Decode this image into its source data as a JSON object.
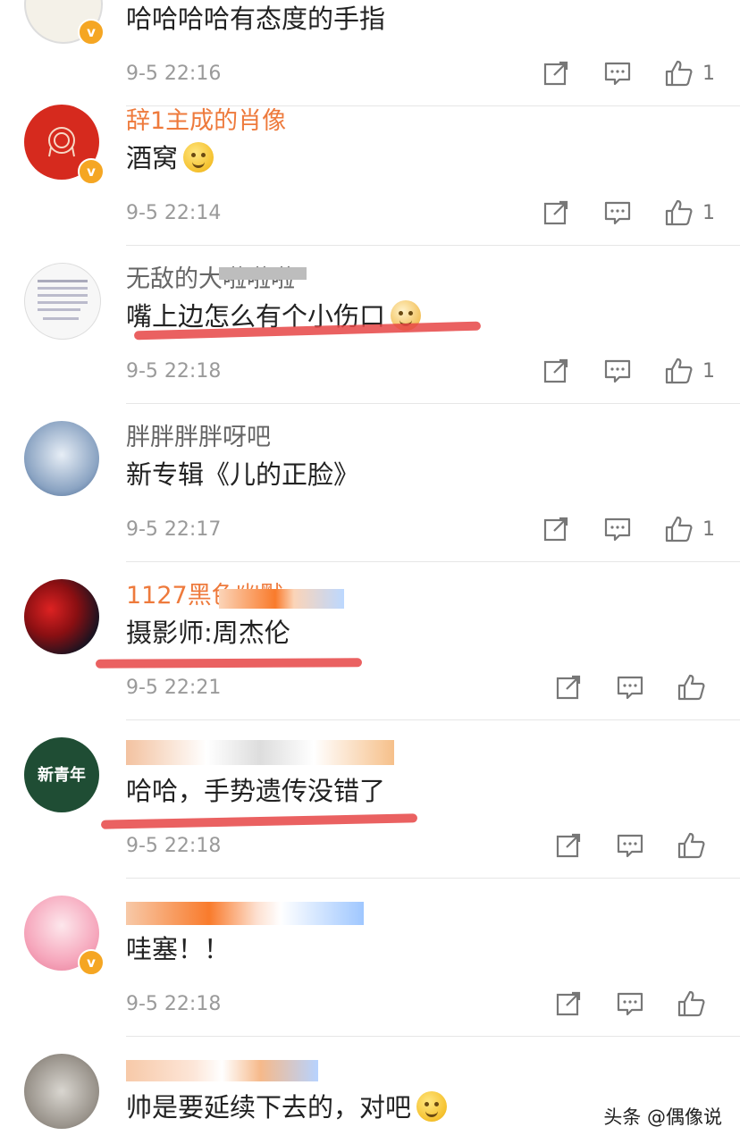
{
  "actions_icons": [
    "share-icon",
    "comment-icon",
    "like-icon"
  ],
  "colors": {
    "username": "#ee7a3c",
    "underline": "#e64545",
    "badge": "#f5a623",
    "time": "#9a9a9a"
  },
  "comments": [
    {
      "username": "",
      "text": "哈哈哈哈有态度的手指",
      "time": "9-5 22:16",
      "likes": "1"
    },
    {
      "username": "辞1主成的肖像",
      "text": "酒窝",
      "time": "9-5 22:14",
      "likes": "1"
    },
    {
      "username": "无敌的大啦啦啦",
      "text": "嘴上边怎么有个小伤口",
      "time": "9-5 22:18",
      "likes": "1"
    },
    {
      "username": "胖胖胖胖呀吧",
      "text": "新专辑《儿的正脸》",
      "time": "9-5 22:17",
      "likes": "1"
    },
    {
      "username": "1127黑色幽默",
      "text": "摄影师:周杰伦",
      "time": "9-5 22:21",
      "likes": ""
    },
    {
      "username": "",
      "text": "哈哈，手势遗传没错了",
      "time": "9-5 22:18",
      "likes": ""
    },
    {
      "username": "",
      "text": "哇塞！！",
      "time": "9-5 22:18",
      "likes": ""
    },
    {
      "username": "",
      "text": "帅是要延续下去的，对吧",
      "time": "",
      "likes": ""
    }
  ],
  "avatar_labels": {
    "xinqingnian": "新青年"
  },
  "watermark": "头条 @偶像说"
}
